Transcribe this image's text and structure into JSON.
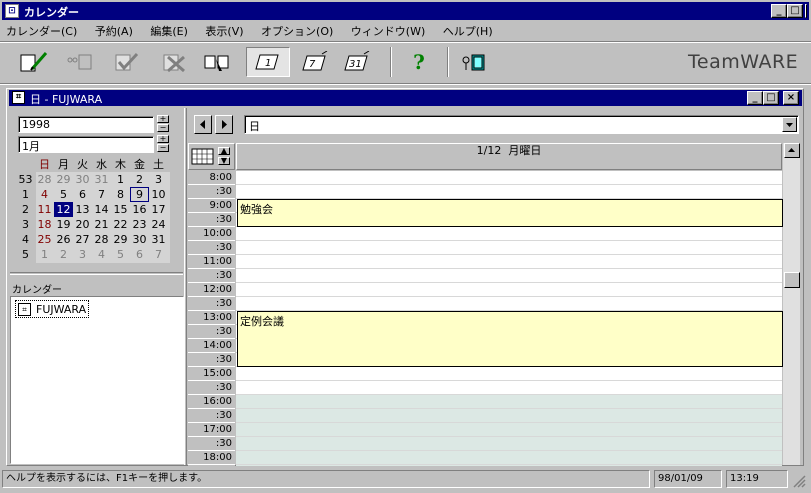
{
  "app": {
    "title": "カレンダー"
  },
  "menu": [
    "カレンダー(C)",
    "予約(A)",
    "編集(E)",
    "表示(V)",
    "オプション(O)",
    "ウィンドウ(W)",
    "ヘルプ(H)"
  ],
  "toolbar": {
    "brand": "TeamWARE",
    "buttons": [
      "new-entry-icon",
      "link-icon",
      "approve-icon",
      "cancel-icon",
      "notice-icon",
      "day-view-icon",
      "week-view-icon",
      "month-view-icon",
      "help-icon",
      "exit-icon"
    ],
    "day_view_label": "1",
    "week_view_label": "7",
    "month_view_label": "31"
  },
  "child": {
    "title": "日 - FUJWARA",
    "year": "1998",
    "month": "1月",
    "weekday_headers": [
      "日",
      "月",
      "火",
      "水",
      "木",
      "金",
      "土"
    ],
    "weeks": [
      {
        "wk": "53",
        "days": [
          "28",
          "29",
          "30",
          "31",
          "1",
          "2",
          "3"
        ]
      },
      {
        "wk": "1",
        "days": [
          "4",
          "5",
          "6",
          "7",
          "8",
          "9",
          "10"
        ]
      },
      {
        "wk": "2",
        "days": [
          "11",
          "12",
          "13",
          "14",
          "15",
          "16",
          "17"
        ]
      },
      {
        "wk": "3",
        "days": [
          "18",
          "19",
          "20",
          "21",
          "22",
          "23",
          "24"
        ]
      },
      {
        "wk": "4",
        "days": [
          "25",
          "26",
          "27",
          "28",
          "29",
          "30",
          "31"
        ]
      },
      {
        "wk": "5",
        "days": [
          "1",
          "2",
          "3",
          "4",
          "5",
          "6",
          "7"
        ]
      }
    ],
    "selected_day": "12",
    "today_day": "9",
    "calendar_list_header": "カレンダー",
    "calendar_list": [
      "FUJWARA"
    ],
    "view_select": "日",
    "date_header": "1/12  月曜日",
    "times": [
      "8:00",
      ":30",
      "9:00",
      ":30",
      "10:00",
      ":30",
      "11:00",
      ":30",
      "12:00",
      ":30",
      "13:00",
      ":30",
      "14:00",
      ":30",
      "15:00",
      ":30",
      "16:00",
      ":30",
      "17:00",
      ":30",
      "18:00"
    ],
    "events": [
      {
        "title": "勉強会",
        "start": "9:00",
        "end": "10:00"
      },
      {
        "title": "定例会議",
        "start": "13:00",
        "end": "15:00"
      }
    ]
  },
  "status": {
    "help": "ヘルプを表示するには、F1キーを押します。",
    "date": "98/01/09",
    "time": "13:19"
  },
  "colors": {
    "titlebar": "#000080",
    "event": "#ffffc8",
    "after_hours": "#dce8e4"
  }
}
